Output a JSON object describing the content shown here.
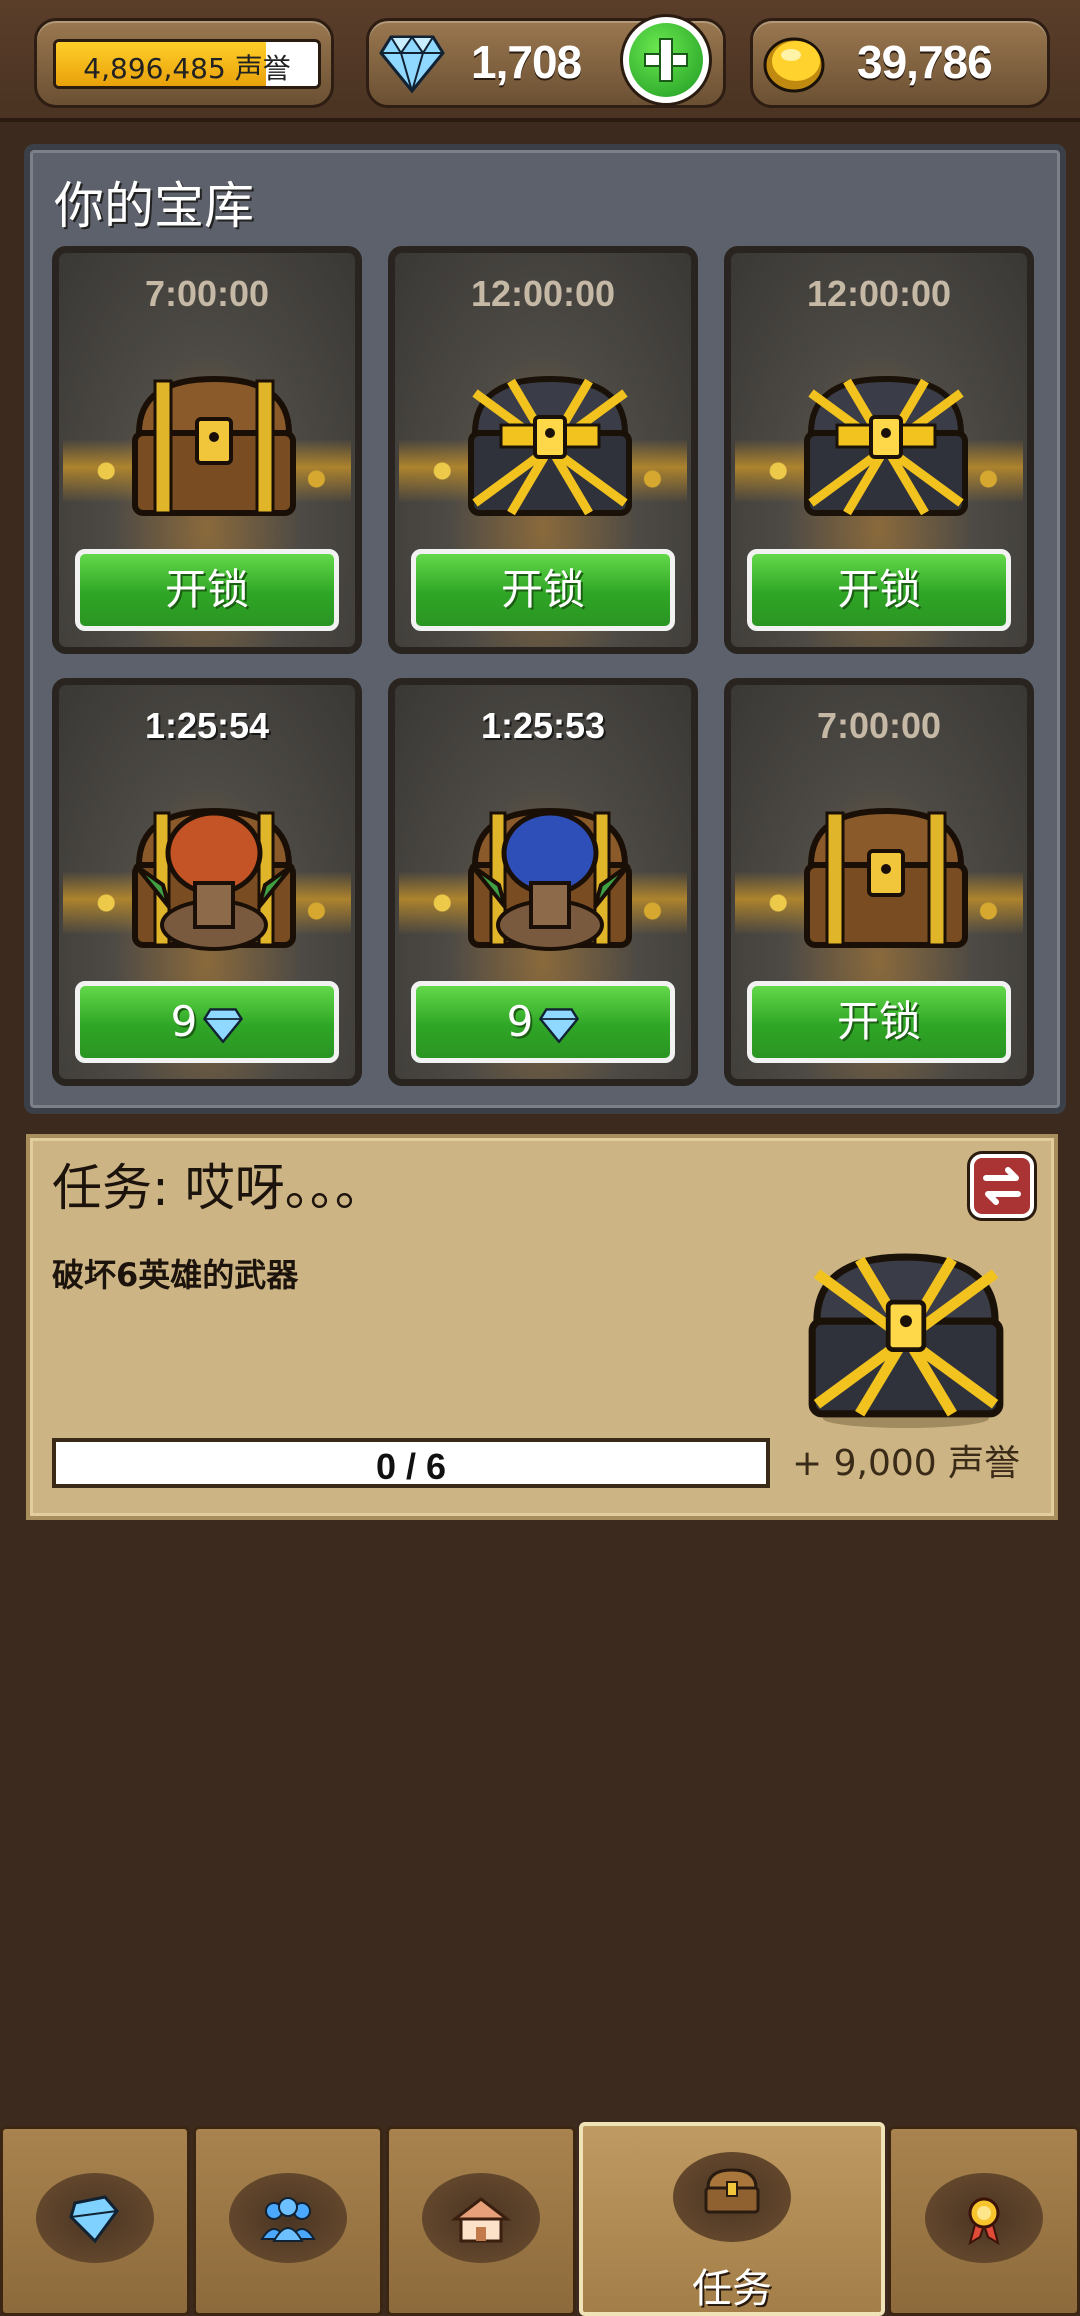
{
  "top_bar": {
    "reputation_text": "4,896,485 声誉",
    "reputation_progress_percent": 80,
    "gems": "1,708",
    "gold": "39,786"
  },
  "treasury": {
    "title": "你的宝库",
    "slots": [
      {
        "timer": "7:00:00",
        "chest": "wooden-chest",
        "button": "开锁",
        "timer_active": false
      },
      {
        "timer": "12:00:00",
        "chest": "gold-chest",
        "button": "开锁",
        "timer_active": false
      },
      {
        "timer": "12:00:00",
        "chest": "gold-chest",
        "button": "开锁",
        "timer_active": false
      },
      {
        "timer": "1:25:54",
        "chest": "goblin-red-chest",
        "button": "9",
        "timer_active": true
      },
      {
        "timer": "1:25:53",
        "chest": "goblin-blue-chest",
        "button": "9",
        "timer_active": true
      },
      {
        "timer": "7:00:00",
        "chest": "wooden-chest",
        "button": "开锁",
        "timer_active": false
      }
    ]
  },
  "quest": {
    "title": "任务: 哎呀。。。",
    "description": "破坏6英雄的武器",
    "progress_text": "0 / 6",
    "progress_current": 0,
    "progress_total": 6,
    "reward": "+ 9,000 声誉"
  },
  "bottom_nav": {
    "tabs": [
      {
        "icon": "gem-icon"
      },
      {
        "icon": "heroes-icon"
      },
      {
        "icon": "village-icon"
      },
      {
        "icon": "chest-icon",
        "label": "任务",
        "active": true
      },
      {
        "icon": "medal-icon"
      }
    ]
  },
  "colors": {
    "background": "#3d2a1e",
    "button_green": "#2fa626",
    "panel_gray": "#5d616b",
    "quest_paper": "#cdb484"
  }
}
